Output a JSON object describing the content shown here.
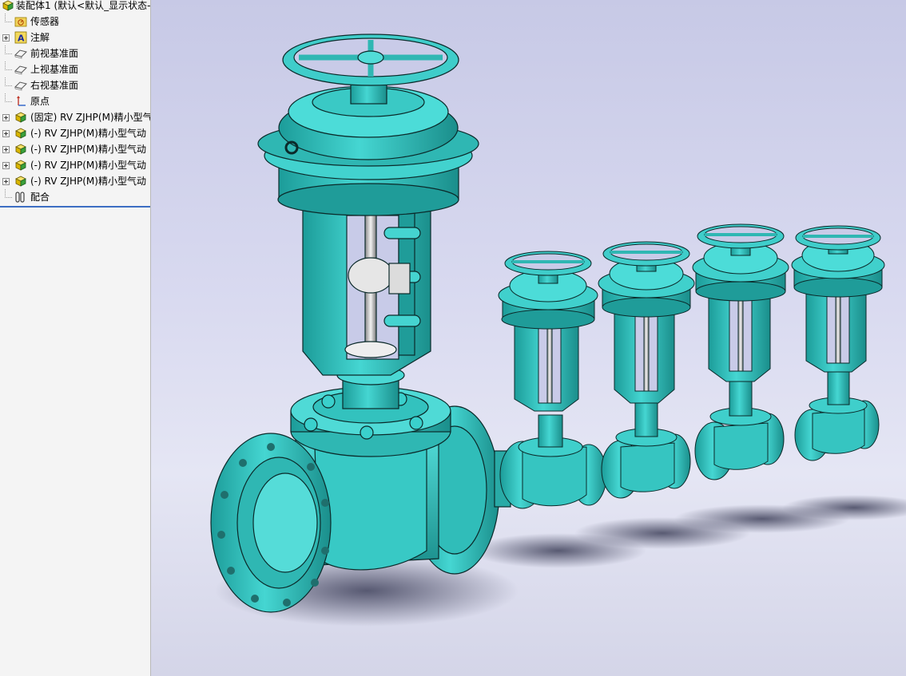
{
  "tree": {
    "root_label": "装配体1 (默认<默认_显示状态-",
    "items": [
      {
        "label": "传感器",
        "icon": "sensor-folder-icon"
      },
      {
        "label": "注解",
        "icon": "annotation-icon"
      },
      {
        "label": "前视基准面",
        "icon": "plane-icon"
      },
      {
        "label": "上视基准面",
        "icon": "plane-icon"
      },
      {
        "label": "右视基准面",
        "icon": "plane-icon"
      },
      {
        "label": "原点",
        "icon": "origin-icon"
      },
      {
        "label": "(固定) RV ZJHP(M)精小型气",
        "icon": "part-icon"
      },
      {
        "label": "(-) RV ZJHP(M)精小型气动",
        "icon": "part-icon"
      },
      {
        "label": "(-) RV ZJHP(M)精小型气动",
        "icon": "part-icon"
      },
      {
        "label": "(-) RV ZJHP(M)精小型气动",
        "icon": "part-icon"
      },
      {
        "label": "(-) RV ZJHP(M)精小型气动",
        "icon": "part-icon"
      },
      {
        "label": "配合",
        "icon": "mates-icon"
      }
    ]
  },
  "viewport": {
    "model_color": "#35c7c4",
    "edge_color": "#0b2a2a",
    "background_top": "#c7c9e6",
    "background_bottom": "#e5e6f4"
  }
}
